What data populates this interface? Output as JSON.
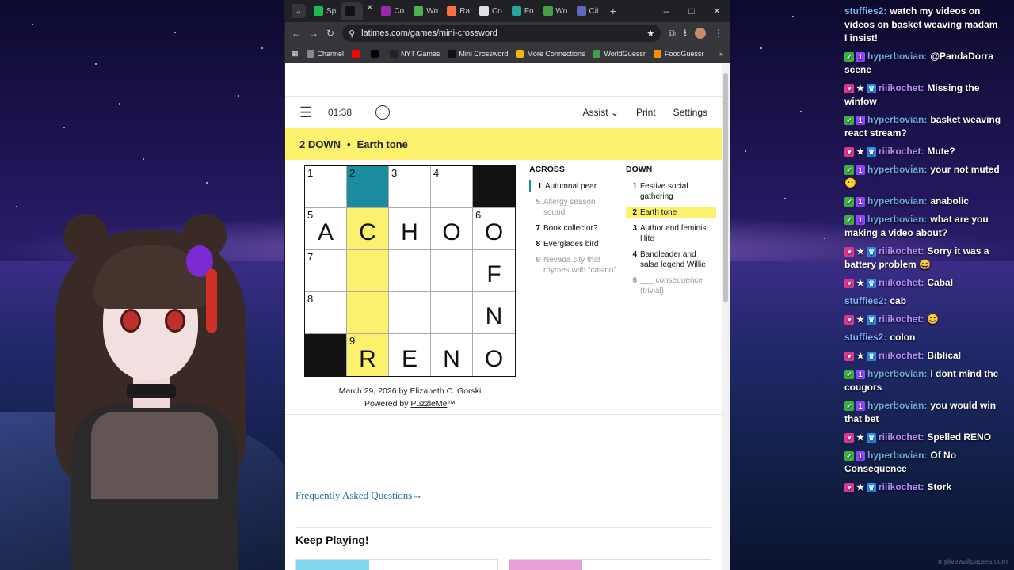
{
  "browser": {
    "tabs": [
      {
        "label": "Sp",
        "color": "#1db954"
      },
      {
        "label": "",
        "color": "#111111",
        "active": true
      },
      {
        "label": "Co",
        "color": "#9c27b0"
      },
      {
        "label": "Wo",
        "color": "#4caf50"
      },
      {
        "label": "Ra",
        "color": "#ff7043"
      },
      {
        "label": "Co",
        "color": "#e0e0e0"
      },
      {
        "label": "Fo",
        "color": "#26a69a"
      },
      {
        "label": "Wo",
        "color": "#43a047"
      },
      {
        "label": "Cit",
        "color": "#5c6bc0"
      }
    ],
    "url": "latimes.com/games/mini-crossword",
    "bookmarks": [
      {
        "label": "Channel",
        "color": "#888888"
      },
      {
        "label": "",
        "color": "#ff0000"
      },
      {
        "label": "",
        "color": "#000000"
      },
      {
        "label": "NYT Games",
        "color": "#222222"
      },
      {
        "label": "Mini Crossword",
        "color": "#111111"
      },
      {
        "label": "More Connections",
        "color": "#f4b400"
      },
      {
        "label": "WorldGuessr",
        "color": "#43a047"
      },
      {
        "label": "FoodGuessr",
        "color": "#fb8c00"
      }
    ]
  },
  "game": {
    "timer": "01:38",
    "menu": {
      "assist": "Assist",
      "assist_caret": "⌄",
      "print": "Print",
      "settings": "Settings"
    },
    "banner": {
      "clue_ref": "2 DOWN",
      "dot": "•",
      "clue_text": "Earth tone"
    },
    "grid": [
      [
        {
          "n": "1",
          "l": ""
        },
        {
          "n": "2",
          "l": "",
          "s": "cur"
        },
        {
          "n": "3",
          "l": ""
        },
        {
          "n": "4",
          "l": ""
        },
        {
          "s": "black"
        }
      ],
      [
        {
          "n": "5",
          "l": "A"
        },
        {
          "n": "",
          "l": "C",
          "s": "hl"
        },
        {
          "n": "",
          "l": "H"
        },
        {
          "n": "",
          "l": "O"
        },
        {
          "n": "6",
          "l": "O"
        }
      ],
      [
        {
          "n": "7",
          "l": ""
        },
        {
          "n": "",
          "l": "",
          "s": "hl"
        },
        {
          "n": "",
          "l": ""
        },
        {
          "n": "",
          "l": ""
        },
        {
          "n": "",
          "l": "F"
        }
      ],
      [
        {
          "n": "8",
          "l": ""
        },
        {
          "n": "",
          "l": "",
          "s": "hl"
        },
        {
          "n": "",
          "l": ""
        },
        {
          "n": "",
          "l": ""
        },
        {
          "n": "",
          "l": "N"
        }
      ],
      [
        {
          "s": "black"
        },
        {
          "n": "9",
          "l": "R",
          "s": "hl"
        },
        {
          "n": "",
          "l": "E"
        },
        {
          "n": "",
          "l": "N"
        },
        {
          "n": "",
          "l": "O"
        }
      ]
    ],
    "byline": "March 29, 2026 by Elizabeth C. Gorski",
    "powered_prefix": "Powered by ",
    "powered_link": "PuzzleMe",
    "powered_suffix": "™",
    "across_title": "ACROSS",
    "down_title": "DOWN",
    "across": [
      {
        "n": "1",
        "t": "Autumnal pear",
        "state": "active"
      },
      {
        "n": "5",
        "t": "Allergy season sound",
        "state": "dim"
      },
      {
        "n": "7",
        "t": "Book collector?",
        "state": ""
      },
      {
        "n": "8",
        "t": "Everglades bird",
        "state": ""
      },
      {
        "n": "9",
        "t": "Nevada city that rhymes with “casino”",
        "state": "dim"
      }
    ],
    "down": [
      {
        "n": "1",
        "t": "Festive social gathering",
        "state": ""
      },
      {
        "n": "2",
        "t": "Earth tone",
        "state": "sel"
      },
      {
        "n": "3",
        "t": "Author and feminist Hite",
        "state": ""
      },
      {
        "n": "4",
        "t": "Bandleader and salsa legend Willie",
        "state": ""
      },
      {
        "n": "6",
        "t": "___ consequence (trivial)",
        "state": "dim"
      }
    ],
    "faq": "Frequently Asked Questions→",
    "keep_playing": "Keep Playing!"
  },
  "chat": [
    {
      "badges": [],
      "name": "stuffies2:",
      "name_color": "#7fb2ff",
      "text": "watch my videos on videos on basket weaving madam I insist!"
    },
    {
      "badges": [
        "check",
        "one"
      ],
      "name": "hyperbovian:",
      "name_color": "#6fa8dc",
      "text": "@PandaDorra scene"
    },
    {
      "badges": [
        "heart",
        "star",
        "crown"
      ],
      "name": "riiikochet:",
      "name_color": "#b58cff",
      "text": "Missing the winfow"
    },
    {
      "badges": [
        "check",
        "one"
      ],
      "name": "hyperbovian:",
      "name_color": "#6fa8dc",
      "text": "basket weaving react stream?"
    },
    {
      "badges": [
        "heart",
        "star",
        "crown"
      ],
      "name": "riiikochet:",
      "name_color": "#b58cff",
      "text": "Mute?"
    },
    {
      "badges": [
        "check",
        "one"
      ],
      "name": "hyperbovian:",
      "name_color": "#6fa8dc",
      "text": "your not muted 😶"
    },
    {
      "badges": [
        "check",
        "one"
      ],
      "name": "hyperbovian:",
      "name_color": "#6fa8dc",
      "text": "anabolic"
    },
    {
      "badges": [
        "check",
        "one"
      ],
      "name": "hyperbovian:",
      "name_color": "#6fa8dc",
      "text": "what are you making a video about?"
    },
    {
      "badges": [
        "heart",
        "star",
        "crown"
      ],
      "name": "riiikochet:",
      "name_color": "#b58cff",
      "text": "Sorry it was a battery problem 😄"
    },
    {
      "badges": [
        "heart",
        "star",
        "crown"
      ],
      "name": "riiikochet:",
      "name_color": "#b58cff",
      "text": "Cabal"
    },
    {
      "badges": [],
      "name": "stuffies2:",
      "name_color": "#7fb2ff",
      "text": "cab"
    },
    {
      "badges": [
        "heart",
        "star",
        "crown"
      ],
      "name": "riiikochet:",
      "name_color": "#b58cff",
      "text": "😄"
    },
    {
      "badges": [],
      "name": "stuffies2:",
      "name_color": "#7fb2ff",
      "text": "colon"
    },
    {
      "badges": [
        "heart",
        "star",
        "crown"
      ],
      "name": "riiikochet:",
      "name_color": "#b58cff",
      "text": "Biblical"
    },
    {
      "badges": [
        "check",
        "one"
      ],
      "name": "hyperbovian:",
      "name_color": "#6fa8dc",
      "text": "i dont mind the cougors"
    },
    {
      "badges": [
        "check",
        "one"
      ],
      "name": "hyperbovian:",
      "name_color": "#6fa8dc",
      "text": "you would win that bet"
    },
    {
      "badges": [
        "heart",
        "star",
        "crown"
      ],
      "name": "riiikochet:",
      "name_color": "#b58cff",
      "text": "Spelled RENO"
    },
    {
      "badges": [
        "check",
        "one"
      ],
      "name": "hyperbovian:",
      "name_color": "#6fa8dc",
      "text": "Of No Consequence"
    },
    {
      "badges": [
        "heart",
        "star",
        "crown"
      ],
      "name": "riiikochet:",
      "name_color": "#b58cff",
      "text": "Stork"
    }
  ],
  "watermark": "mylivewallpapers.com"
}
